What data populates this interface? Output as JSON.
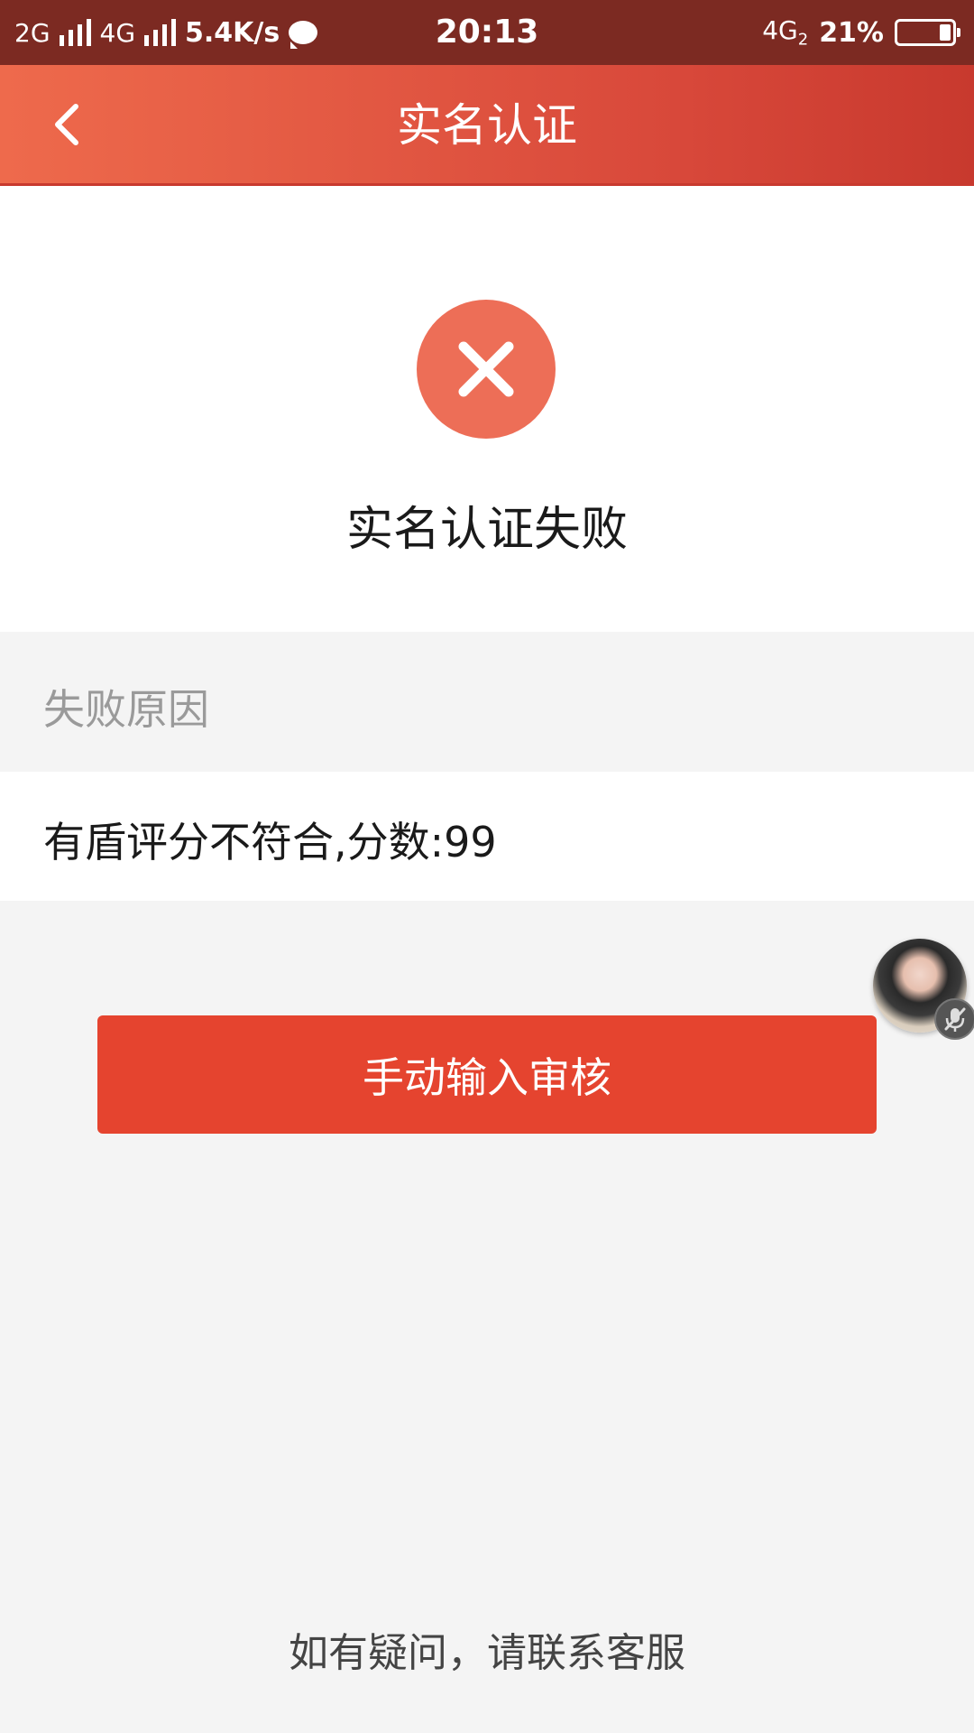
{
  "status_bar": {
    "net1": "2G",
    "net2": "4G",
    "speed": "5.4K/s",
    "time": "20:13",
    "net3": "4G",
    "net3_sub": "2",
    "battery": "21%",
    "battery_level": 0.21
  },
  "header": {
    "title": "实名认证",
    "back_icon": "chevron-left-icon",
    "gradient": [
      "#ee6a4c",
      "#c8392e"
    ]
  },
  "result": {
    "icon": "close-icon",
    "icon_color": "#ed6e57",
    "title": "实名认证失败"
  },
  "reason": {
    "label": "失败原因",
    "text": "有盾评分不符合,分数:99"
  },
  "actions": {
    "manual_review_label": "手动输入审核",
    "button_color": "#e5442f"
  },
  "footer": {
    "contact_text": "如有疑问，请联系客服"
  }
}
